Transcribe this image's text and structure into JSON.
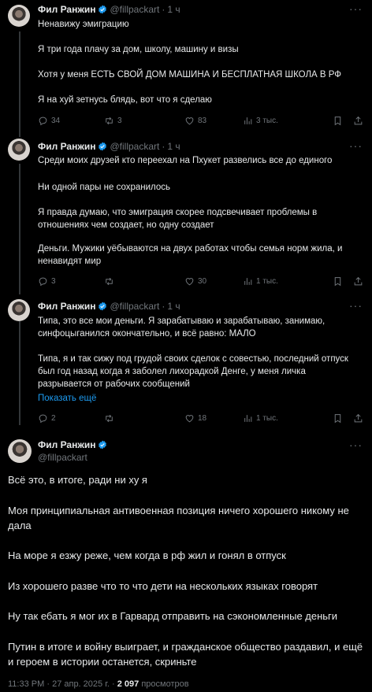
{
  "author": {
    "name": "Фил Ранжин",
    "handle": "@fillpackart",
    "dot": "·",
    "verified_color": "#1d9bf0"
  },
  "tweets": [
    {
      "time": "1 ч",
      "paragraphs": [
        "Ненавижу эмиграцию",
        "Я три года плачу за дом, школу, машину и визы",
        "Хотя у меня ЕСТЬ СВОЙ ДОМ МАШИНА И БЕСПЛАТНАЯ ШКОЛА В РФ",
        "Я на хуй зетнусь блядь, вот что я сделаю"
      ],
      "replies": "34",
      "retweets": "3",
      "likes": "83",
      "views": "3 тыс."
    },
    {
      "time": "1 ч",
      "paragraphs": [
        "Среди моих друзей кто переехал на Пхукет развелись все до единого",
        "Ни одной пары не сохранилось",
        "Я правда думаю, что эмиграция скорее подсвечивает проблемы в отношениях чем создает, но одну создает",
        "Деньги. Мужики уёбываются на двух работах чтобы семья норм жила, и ненавидят мир"
      ],
      "replies": "3",
      "retweets": "",
      "likes": "30",
      "views": "1 тыс."
    },
    {
      "time": "1 ч",
      "paragraphs": [
        "Типа, это все мои деньги. Я зарабатываю и зарабатываю, занимаю, синфоцыганился окончательно, и всё равно: МАЛО",
        "Типа, я и так сижу под грудой своих сделок с совестью, последний отпуск был год назад когда я заболел лихорадкой Денге, у меня личка разрывается от рабочих сообщений"
      ],
      "show_more": "Показать ещё",
      "replies": "2",
      "retweets": "",
      "likes": "18",
      "views": "1 тыс."
    }
  ],
  "main_tweet": {
    "paragraphs": [
      "Всё это, в итоге, ради ни ху я",
      "Моя принципиальная антивоенная позиция ничего хорошего никому не дала",
      "На море я езжу реже, чем когда в рф жил и гонял в отпуск",
      "Из хорошего разве что то что дети на нескольких языках говорят",
      "Ну так ебать я мог их в Гарвард отправить на сэкономленные деньги",
      "Путин в итоге и войну выиграет, и гражданское общество раздавил, и ещё и героем в истории останется, скриньте"
    ],
    "time": "11:33 PM",
    "date": "27 апр. 2025 г.",
    "views_count": "2 097",
    "views_label": "просмотров"
  },
  "icons": {
    "reply": "reply-icon",
    "retweet": "retweet-icon",
    "like": "heart-icon",
    "views": "views-icon",
    "bookmark": "bookmark-icon",
    "share": "share-icon",
    "more": "more-icon",
    "verified": "verified-badge-icon"
  }
}
